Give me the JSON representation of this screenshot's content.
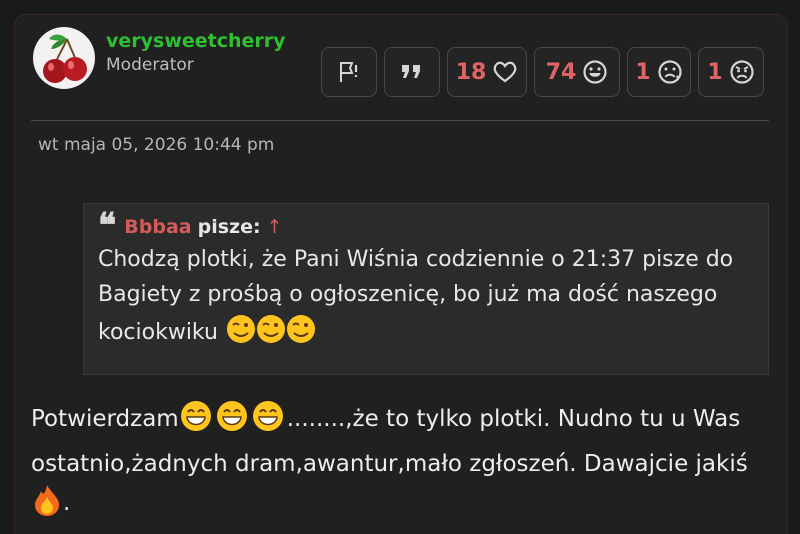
{
  "post": {
    "username": "verysweetcherry",
    "rank": "Moderator",
    "date": "wt maja 05, 2026 10:44 pm",
    "reactions": [
      {
        "count": "18",
        "icon": "heart-icon"
      },
      {
        "count": "74",
        "icon": "smile-icon"
      },
      {
        "count": "1",
        "icon": "sad-tear-icon"
      },
      {
        "count": "1",
        "icon": "angry-icon"
      }
    ],
    "colors": {
      "username": "#2fbf2f",
      "counts": "#e06464",
      "quote_author": "#d35b5b"
    }
  },
  "quote": {
    "author": "Bbbaa",
    "says": "pisze:",
    "arrow": "↑",
    "text": "Chodzą plotki, że Pani Wiśnia codziennie o 21:37 pisze do\nBagiety z prośbą o ogłoszenicę, bo już ma dość naszego\nkociokwiku"
  },
  "message": {
    "part1": "Potwierdzam",
    "part2": "........,że to tylko plotki. Nudno tu u Was ostatnio,żadnych dram,awantur,mało zgłoszeń. Dawajcie jakiś ",
    "part3": "."
  }
}
